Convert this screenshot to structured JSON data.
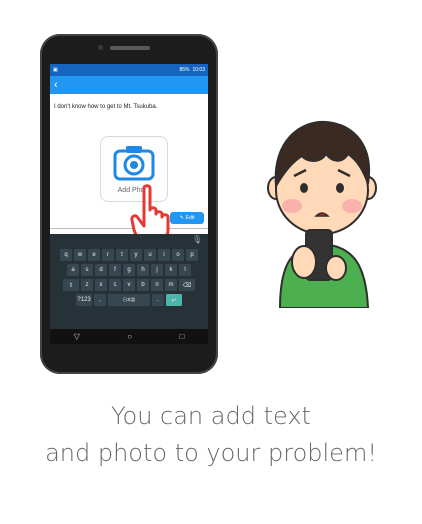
{
  "statusbar": {
    "battery": "85%",
    "time": "10:03"
  },
  "appbar": {
    "back_icon": "back-arrow-icon"
  },
  "message": {
    "text": "I don't know how to get to Mt. Tsukuba."
  },
  "photo_button": {
    "label": "Add Photo",
    "icon": "camera-icon"
  },
  "edit_button": {
    "label": "Edit"
  },
  "keyboard": {
    "row1": [
      "q",
      "w",
      "e",
      "r",
      "t",
      "y",
      "u",
      "i",
      "o",
      "p"
    ],
    "row2": [
      "a",
      "s",
      "d",
      "f",
      "g",
      "h",
      "j",
      "k",
      "l"
    ],
    "row3": [
      "z",
      "x",
      "c",
      "v",
      "b",
      "n",
      "m"
    ],
    "row4_left": "?123",
    "space": "日本語",
    "row4_mid": "."
  },
  "navbar": {
    "back": "▽",
    "home": "○",
    "recent": "□"
  },
  "caption": {
    "line1": "You can add text",
    "line2": "and photo to your problem!"
  },
  "colors": {
    "appbar": "#2196f3",
    "statusbar": "#1565c0",
    "keyboard": "#263238",
    "caption": "#666666",
    "hand_outline": "#e53935"
  }
}
